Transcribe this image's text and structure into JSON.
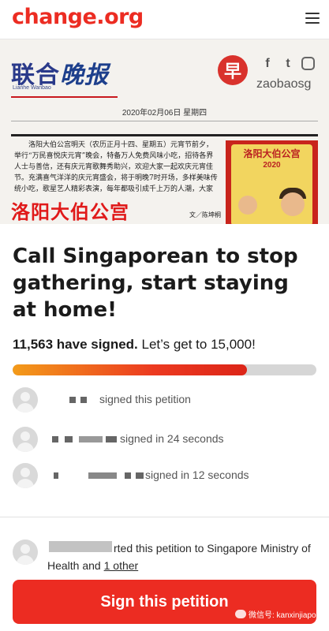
{
  "header": {
    "logo": "change.org",
    "menu_icon": "hamburger-icon"
  },
  "newspaper": {
    "brand_cn": "联合",
    "brand_cn_big": "晚报",
    "brand_en": "Lianhe Wanbao",
    "publisher_icon_char": "早",
    "social_icons": [
      "facebook-icon",
      "twitter-icon",
      "instagram-icon"
    ],
    "handle": "zaobaosg",
    "date": "2020年02月06日 星期四",
    "article_text": "洛阳大伯公宫明天（农历正月十四、星期五）元宵节前夕，举行“万民喜悦庆元宵”晚会，特备万人免费风味小吃，招待各界人士与善信，还有庆元宵歌舞秀助兴，欢迎大家一起欢庆元宵佳节。充满喜气洋洋的庆元宵盛会，将于明晚7时开场，多样美味传统小吃，歌星艺人精彩表演，每年都吸引成千上万的人潮，大家不要错过。",
    "headline": "洛阳大伯公宫",
    "byline": "文／陈坤桐",
    "poster_title": "洛阳大伯公宫",
    "poster_year": "2020"
  },
  "petition": {
    "title": "Call Singaporean to stop gathering, start staying at home!",
    "signed_count": "11,563 have signed.",
    "goal_text": " Let’s get to 15,000!",
    "progress_fraction": 0.7709
  },
  "signers": [
    {
      "text": "signed this petition"
    },
    {
      "text": "signed in 24 seconds"
    },
    {
      "text": "signed in 12 seconds"
    }
  ],
  "starter": {
    "text_prefix": "rted this petition to Singapore Ministry of Health",
    "and_text": " and ",
    "other_link": "1 other"
  },
  "cta": {
    "sign_label": "Sign this petition"
  },
  "watermark": {
    "text": "微信号: kanxinjiapo"
  },
  "colors": {
    "brand_red": "#ec2c22",
    "progress_start": "#f39b1a",
    "progress_end": "#dc2518"
  }
}
